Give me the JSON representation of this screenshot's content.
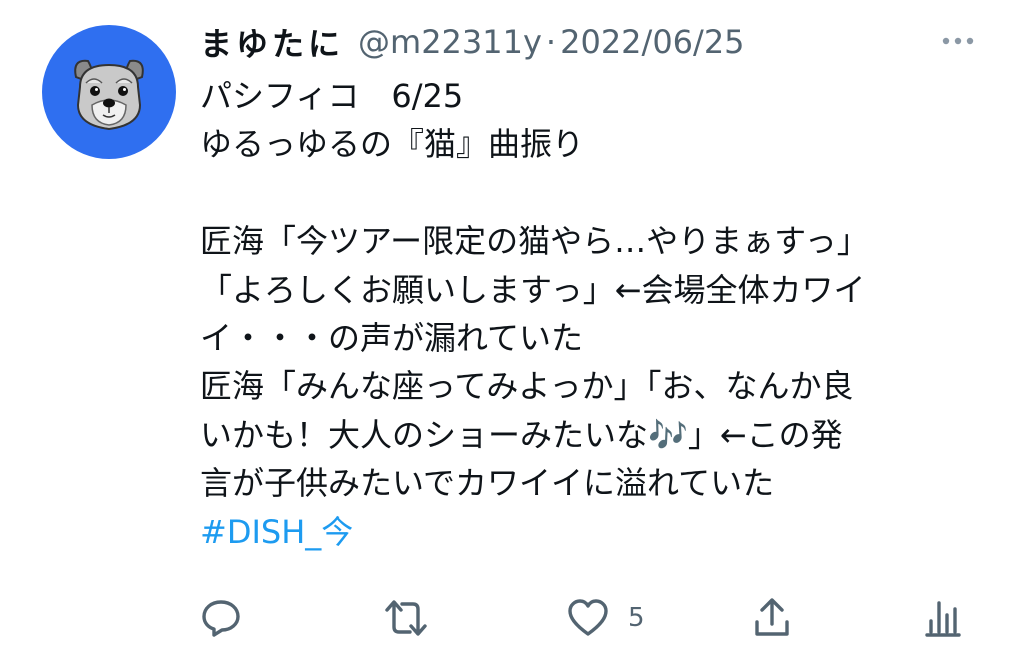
{
  "user": {
    "display_name": "まゆたに",
    "handle": "@m22311y",
    "separator": "·",
    "date": "2022/06/25"
  },
  "tweet": {
    "lines": [
      "パシフィコ　6/25",
      "ゆるっゆるの『猫』曲振り",
      "",
      "匠海「今ツアー限定の猫やら…やりまぁすっ」",
      "「よろしくお願いしますっ」←会場全体カワイ",
      "イ・・・の声が漏れていた",
      "匠海「みんな座ってみよっか」「お、なんか良",
      "いかも！大人のショーみたいな🎶」←この発",
      "言が子供みたいでカワイイに溢れていた"
    ],
    "hashtag": "#DISH_今"
  },
  "actions": {
    "reply_icon": "reply-icon",
    "retweet_icon": "retweet-icon",
    "like_icon": "heart-icon",
    "like_count": "5",
    "share_icon": "share-icon",
    "analytics_icon": "analytics-icon"
  },
  "colors": {
    "text": "#0f1419",
    "secondary": "#536471",
    "link": "#1d9bf0",
    "avatar_bg": "#2f6ff0"
  }
}
